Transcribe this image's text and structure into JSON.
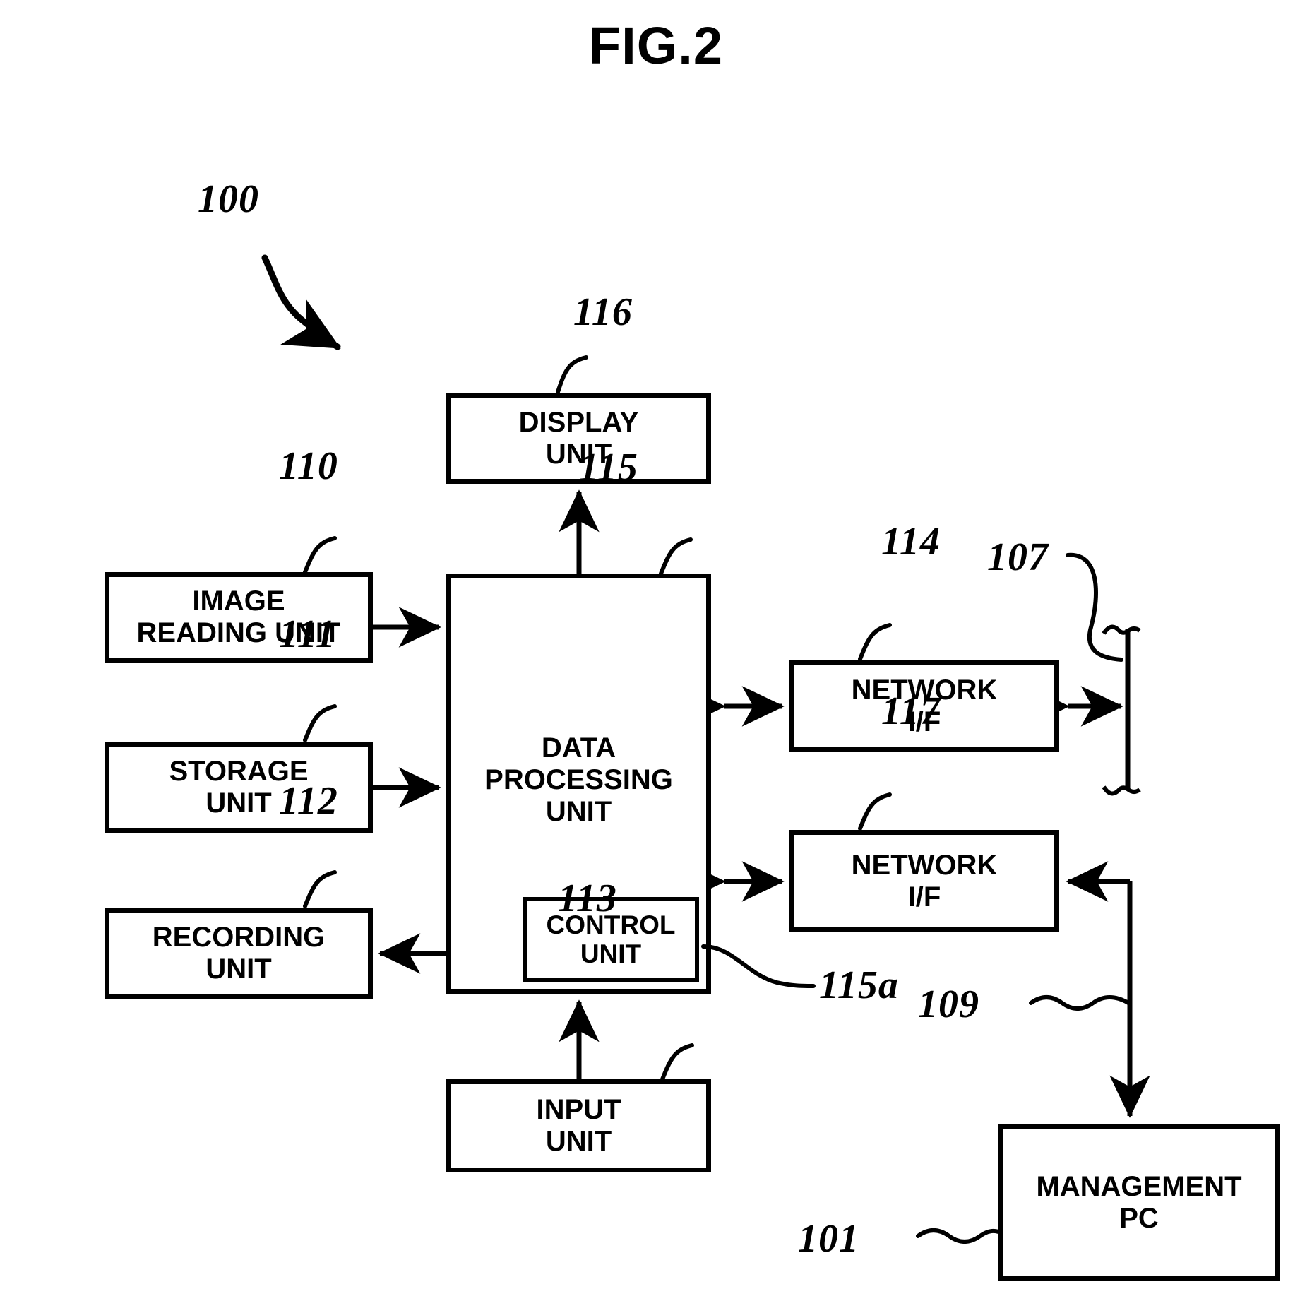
{
  "figure": {
    "title": "FIG.2",
    "line_color": "#000000",
    "background_color": "#ffffff"
  },
  "blocks": [
    {
      "id": "display_unit",
      "label": "DISPLAY\nUNIT",
      "lines": [
        "DISPLAY",
        "UNIT"
      ],
      "ref": "116"
    },
    {
      "id": "image_reading_unit",
      "label": "IMAGE\nREADING UNIT",
      "lines": [
        "IMAGE",
        "READING UNIT"
      ],
      "ref": "110"
    },
    {
      "id": "storage_unit",
      "label": "STORAGE\nUNIT",
      "lines": [
        "STORAGE",
        "UNIT"
      ],
      "ref": "111"
    },
    {
      "id": "recording_unit",
      "label": "RECORDING\nUNIT",
      "lines": [
        "RECORDING",
        "UNIT"
      ],
      "ref": "112"
    },
    {
      "id": "data_processing_unit",
      "label": "DATA\nPROCESSING\nUNIT",
      "lines": [
        "DATA",
        "PROCESSING",
        "UNIT"
      ],
      "ref": "115"
    },
    {
      "id": "control_unit",
      "label": "CONTROL\nUNIT",
      "lines": [
        "CONTROL",
        "UNIT"
      ],
      "ref": "115a"
    },
    {
      "id": "input_unit",
      "label": "INPUT\nUNIT",
      "lines": [
        "INPUT",
        "UNIT"
      ],
      "ref": "113"
    },
    {
      "id": "network_if_top",
      "label": "NETWORK\nI/F",
      "lines": [
        "NETWORK",
        "I/F"
      ],
      "ref": "114"
    },
    {
      "id": "network_if_bottom",
      "label": "NETWORK\nI/F",
      "lines": [
        "NETWORK",
        "I/F"
      ],
      "ref": "117"
    },
    {
      "id": "management_pc",
      "label": "MANAGEMENT\nPC",
      "lines": [
        "MANAGEMENT",
        "PC"
      ],
      "ref": "101"
    }
  ],
  "box_text": {
    "display_unit_l1": "DISPLAY",
    "display_unit_l2": "UNIT",
    "image_reading_unit_l1": "IMAGE",
    "image_reading_unit_l2": "READING UNIT",
    "storage_unit_l1": "STORAGE",
    "storage_unit_l2": "UNIT",
    "recording_unit_l1": "RECORDING",
    "recording_unit_l2": "UNIT",
    "data_processing_unit_l1": "DATA",
    "data_processing_unit_l2": "PROCESSING",
    "data_processing_unit_l3": "UNIT",
    "control_unit_l1": "CONTROL",
    "control_unit_l2": "UNIT",
    "input_unit_l1": "INPUT",
    "input_unit_l2": "UNIT",
    "network_if_top_l1": "NETWORK",
    "network_if_top_l2": "I/F",
    "network_if_bottom_l1": "NETWORK",
    "network_if_bottom_l2": "I/F",
    "management_pc_l1": "MANAGEMENT",
    "management_pc_l2": "PC"
  },
  "reference_numerals": {
    "system": "100",
    "management_pc": "101",
    "network_bus": "107",
    "pc_link": "109",
    "image_reading_unit": "110",
    "storage_unit": "111",
    "recording_unit": "112",
    "input_unit": "113",
    "network_if_top": "114",
    "data_processing_unit": "115",
    "control_unit": "115a",
    "display_unit": "116",
    "network_if_bottom": "117"
  },
  "connections": [
    {
      "from": "image_reading_unit",
      "to": "data_processing_unit",
      "direction": "one-way"
    },
    {
      "from": "storage_unit",
      "to": "data_processing_unit",
      "direction": "two-way"
    },
    {
      "from": "data_processing_unit",
      "to": "recording_unit",
      "direction": "one-way"
    },
    {
      "from": "input_unit",
      "to": "data_processing_unit",
      "direction": "one-way"
    },
    {
      "from": "data_processing_unit",
      "to": "display_unit",
      "direction": "one-way"
    },
    {
      "from": "data_processing_unit",
      "to": "network_if_top",
      "direction": "two-way"
    },
    {
      "from": "network_if_top",
      "to": "network_bus",
      "direction": "two-way"
    },
    {
      "from": "data_processing_unit",
      "to": "network_if_bottom",
      "direction": "two-way"
    },
    {
      "from": "management_pc",
      "to": "network_if_bottom",
      "direction": "one-way"
    },
    {
      "from": "pc_link",
      "to": "management_pc",
      "direction": "one-way"
    }
  ]
}
